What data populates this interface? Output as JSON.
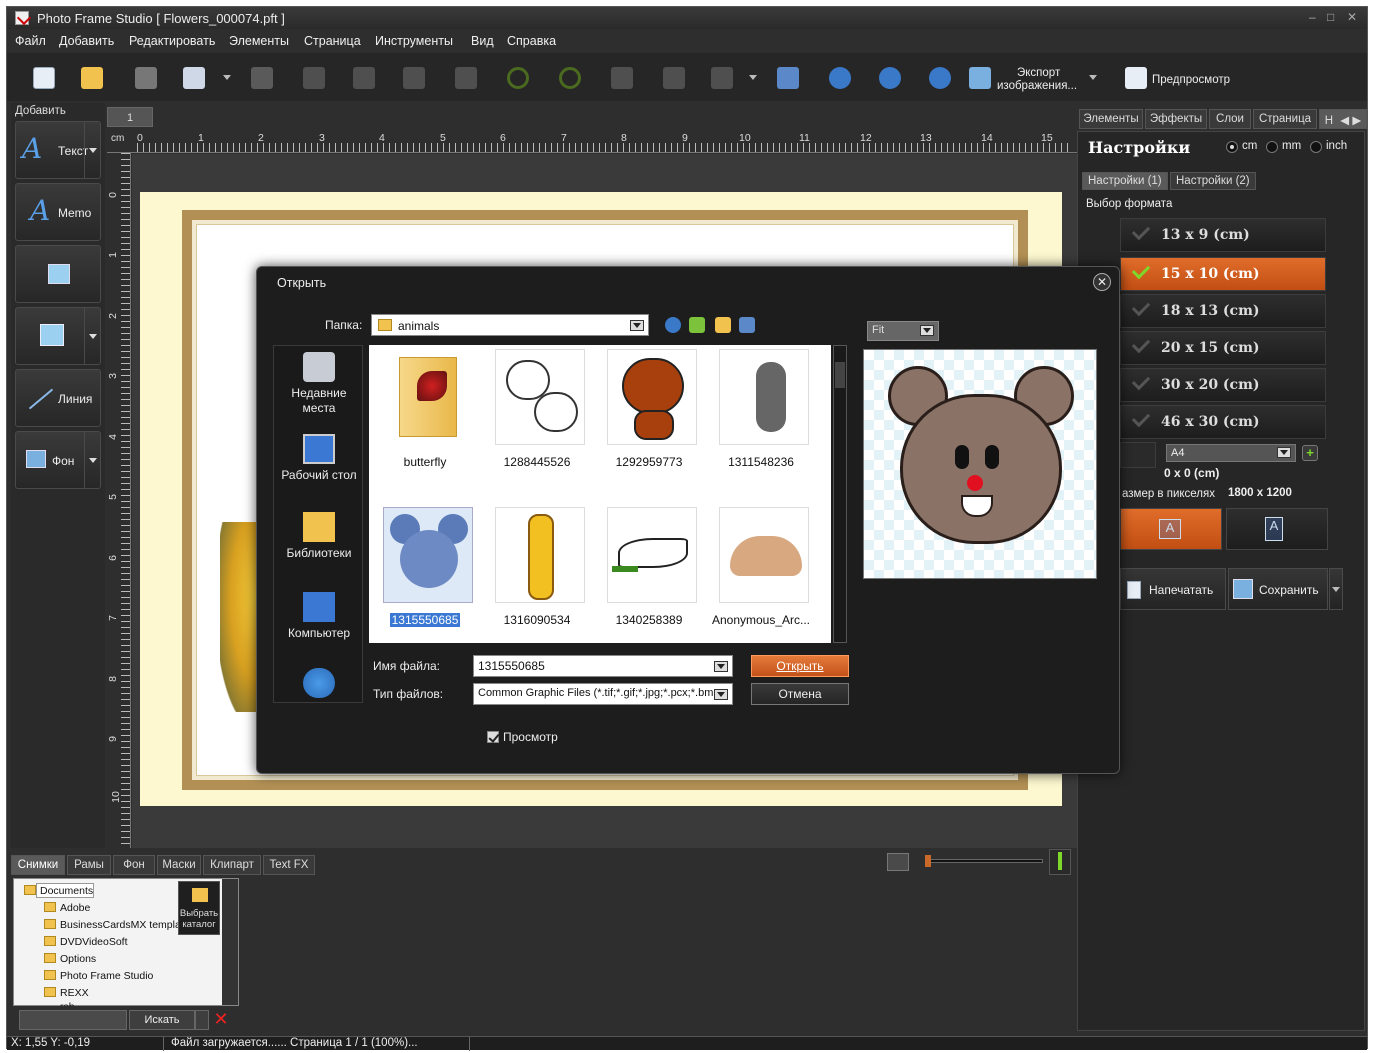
{
  "window": {
    "title": "Photo Frame Studio [ Flowers_000074.pft ]"
  },
  "menu": [
    "Файл",
    "Добавить",
    "Редактировать",
    "Элементы",
    "Страница",
    "Инструменты",
    "Вид",
    "Справка"
  ],
  "toolbar": {
    "export_label_1": "Экспорт",
    "export_label_2": "изображения...",
    "preview_label": "Предпросмотр"
  },
  "left_panel": {
    "header": "Добавить",
    "buttons": [
      {
        "label": "Текст",
        "icon": "text-a-icon"
      },
      {
        "label": "Memo",
        "icon": "memo-a-icon"
      },
      {
        "label": "",
        "icon": "add-image-icon"
      },
      {
        "label": "",
        "icon": "rectangle-icon"
      },
      {
        "label": "Линия",
        "icon": "line-icon"
      },
      {
        "label": "Фон",
        "icon": "background-icon"
      }
    ]
  },
  "canvas": {
    "page_tab": "1",
    "ruler_unit": "cm",
    "ruler_h": [
      "0",
      "1",
      "2",
      "3",
      "4",
      "5",
      "6",
      "7",
      "8",
      "9",
      "10",
      "11",
      "12",
      "13",
      "14",
      "15"
    ],
    "ruler_v": [
      "0",
      "1",
      "2",
      "3",
      "4",
      "5",
      "6",
      "7",
      "8",
      "9",
      "10"
    ]
  },
  "bottom_panel": {
    "tabs": [
      "Снимки",
      "Рамы",
      "Фон",
      "Маски",
      "Клипарт",
      "Text FX"
    ],
    "tree": [
      "Documents",
      "Adobe",
      "BusinessCardsMX templat",
      "DVDVideoSoft",
      "Options",
      "Photo Frame Studio",
      "REXX",
      "rsb"
    ],
    "pick_dir_1": "Выбрать",
    "pick_dir_2": "каталог",
    "search_label": "Искать"
  },
  "right_panel": {
    "tabs": [
      "Элементы",
      "Эффекты",
      "Слои",
      "Страница",
      "Н"
    ],
    "title": "Настройки",
    "units": [
      "cm",
      "mm",
      "inch"
    ],
    "selected_unit": "cm",
    "subtabs": [
      "Настройки (1)",
      "Настройки (2)"
    ],
    "format_header": "Выбор формата",
    "formats": [
      "13 x 9 (cm)",
      "15 x 10 (cm)",
      "18 x 13 (cm)",
      "20 x 15 (cm)",
      "30 x 20 (cm)",
      "46 x 30 (cm)"
    ],
    "selected_format": "15 x 10 (cm)",
    "custom_format": "A4",
    "custom_size": "0 x 0 (cm)",
    "pixel_size_label": "азмер в пикселях",
    "pixel_size_value": "1800 x 1200",
    "orientation_letter": "A",
    "print_label": "Напечатать",
    "save_label": "Сохранить"
  },
  "dialog": {
    "title": "Открыть",
    "folder_label": "Папка:",
    "folder_value": "animals",
    "places": [
      "Недавние места",
      "Рабочий стол",
      "Библиотеки",
      "Компьютер",
      ""
    ],
    "files": [
      {
        "name": "butterfly",
        "icon": "folder-butterfly-icon"
      },
      {
        "name": "1288445526",
        "icon": "kittens-thumbnail"
      },
      {
        "name": "1292959773",
        "icon": "bear-thumbnail"
      },
      {
        "name": "1311548236",
        "icon": "cat-thumbnail"
      },
      {
        "name": "1315550685",
        "icon": "mouse-thumbnail"
      },
      {
        "name": "1316090534",
        "icon": "giraffe-thumbnail"
      },
      {
        "name": "1340258389",
        "icon": "dove-thumbnail"
      },
      {
        "name": "Anonymous_Arc...",
        "icon": "dinosaur-thumbnail"
      }
    ],
    "selected_file": "1315550685",
    "fit_label": "Fit",
    "filename_label": "Имя файла:",
    "filename_value": "1315550685",
    "filetype_label": "Тип файлов:",
    "filetype_value": "Common Graphic Files (*.tif;*.gif;*.jpg;*.pcx;*.bm",
    "open_label": "Открыть",
    "cancel_label": "Отмена",
    "preview_checkbox": "Просмотр",
    "preview_checked": true
  },
  "status": {
    "coords": "X: 1,55 Y: -0,19",
    "message": "Файл загружается...... Страница 1 / 1 (100%)..."
  }
}
